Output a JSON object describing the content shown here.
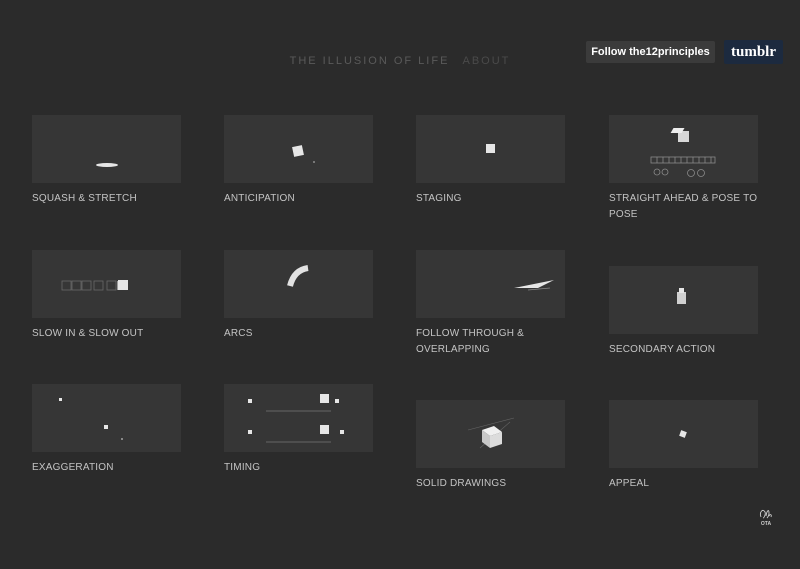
{
  "nav": {
    "home_label": "THE ILLUSION OF LIFE",
    "about_label": "ABOUT"
  },
  "follow_button": "Follow the12principles",
  "tumblr_button": "tumblr",
  "cards": [
    {
      "label": "SQUASH & STRETCH"
    },
    {
      "label": "ANTICIPATION"
    },
    {
      "label": "STAGING"
    },
    {
      "label": "STRAIGHT AHEAD & POSE TO POSE"
    },
    {
      "label": "SLOW IN & SLOW OUT"
    },
    {
      "label": "ARCS"
    },
    {
      "label": "FOLLOW THROUGH & OVERLAPPING"
    },
    {
      "label": "SECONDARY ACTION"
    },
    {
      "label": "EXAGGERATION"
    },
    {
      "label": "TIMING"
    },
    {
      "label": "SOLID DRAWINGS"
    },
    {
      "label": "APPEAL"
    }
  ],
  "signature_text": "OTA",
  "colors": {
    "background": "#2b2b2b",
    "thumbnail": "#363636",
    "tumblr_brand": "#1c2a3f"
  }
}
